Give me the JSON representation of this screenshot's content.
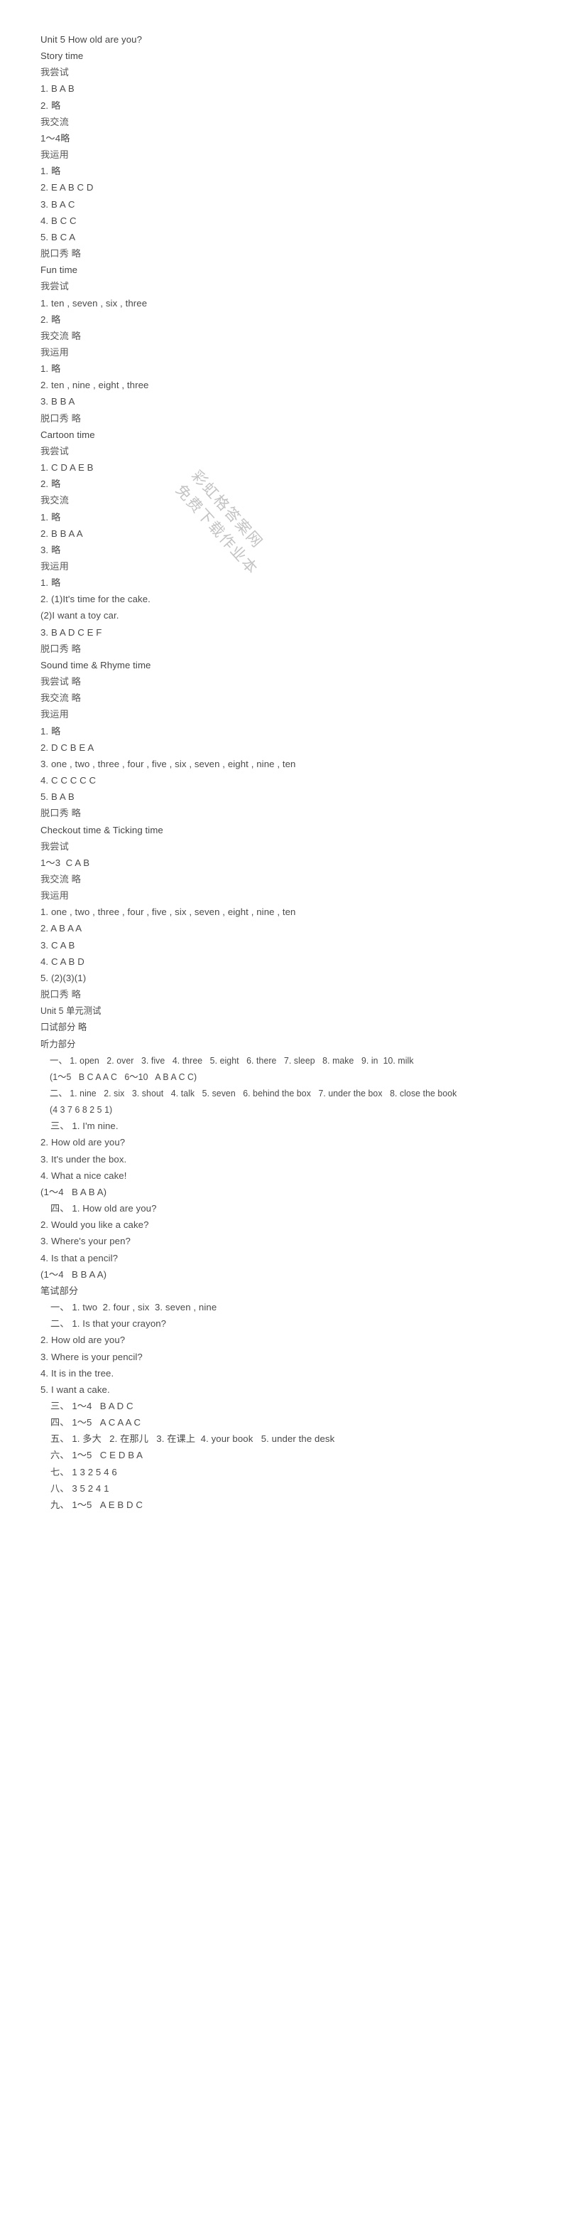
{
  "document": {
    "title": "Unit 5 How old are you?",
    "watermark": {
      "lines": [
        "彩虹格答案网",
        "免费下载作业本"
      ],
      "color": "#b9b9b9"
    },
    "body_lines": [
      {
        "text": "Unit 5 How old are you?",
        "style": "hd"
      },
      {
        "text": "Story time",
        "style": "hd"
      },
      {
        "text": "我尝试",
        "style": "cn"
      },
      {
        "text": "1. B A B",
        "style": ""
      },
      {
        "text": "2. 略",
        "style": ""
      },
      {
        "text": "我交流",
        "style": "cn"
      },
      {
        "text": "1～4略",
        "style": ""
      },
      {
        "text": "我运用",
        "style": "cn"
      },
      {
        "text": "1. 略",
        "style": ""
      },
      {
        "text": "2. E A B C D",
        "style": ""
      },
      {
        "text": "3. B A C",
        "style": ""
      },
      {
        "text": "4. B C C",
        "style": ""
      },
      {
        "text": "5. B C A",
        "style": ""
      },
      {
        "text": "脱口秀 略",
        "style": "cn"
      },
      {
        "text": "Fun time",
        "style": "hd"
      },
      {
        "text": "我尝试",
        "style": "cn"
      },
      {
        "text": "1. ten , seven , six , three",
        "style": ""
      },
      {
        "text": "2. 略",
        "style": ""
      },
      {
        "text": "我交流 略",
        "style": "cn"
      },
      {
        "text": "我运用",
        "style": "cn"
      },
      {
        "text": "1. 略",
        "style": ""
      },
      {
        "text": "2. ten , nine , eight , three",
        "style": ""
      },
      {
        "text": "3. B B A",
        "style": ""
      },
      {
        "text": "脱口秀 略",
        "style": "cn"
      },
      {
        "text": "Cartoon time",
        "style": "hd"
      },
      {
        "text": "我尝试",
        "style": "cn"
      },
      {
        "text": "1. C D A E B",
        "style": ""
      },
      {
        "text": "2. 略",
        "style": ""
      },
      {
        "text": "我交流",
        "style": "cn"
      },
      {
        "text": "1. 略",
        "style": ""
      },
      {
        "text": "2. B B A A",
        "style": ""
      },
      {
        "text": "3. 略",
        "style": ""
      },
      {
        "text": "我运用",
        "style": "cn"
      },
      {
        "text": "1. 略",
        "style": ""
      },
      {
        "text": "2. (1)It's time for the cake.",
        "style": ""
      },
      {
        "text": "(2)I want a toy car.",
        "style": ""
      },
      {
        "text": "3. B A D C E F",
        "style": ""
      },
      {
        "text": "脱口秀 略",
        "style": "cn"
      },
      {
        "text": "Sound time & Rhyme time",
        "style": "hd"
      },
      {
        "text": "我尝试 略",
        "style": "cn"
      },
      {
        "text": "我交流 略",
        "style": "cn"
      },
      {
        "text": "我运用",
        "style": "cn"
      },
      {
        "text": "1. 略",
        "style": ""
      },
      {
        "text": "2. D C B E A",
        "style": ""
      },
      {
        "text": "3. one , two , three , four , five , six , seven , eight , nine , ten",
        "style": ""
      },
      {
        "text": "4. C C C C C",
        "style": ""
      },
      {
        "text": "5. B A B",
        "style": ""
      },
      {
        "text": "脱口秀 略",
        "style": "cn"
      },
      {
        "text": "Checkout time & Ticking time",
        "style": "hd"
      },
      {
        "text": "我尝试",
        "style": "cn"
      },
      {
        "text": "1～3  C A B",
        "style": ""
      },
      {
        "text": "我交流 略",
        "style": "cn"
      },
      {
        "text": "我运用",
        "style": "cn"
      },
      {
        "text": "1. one , two , three , four , five , six , seven , eight , nine , ten",
        "style": ""
      },
      {
        "text": "2. A B A A",
        "style": ""
      },
      {
        "text": "3. C A B",
        "style": ""
      },
      {
        "text": "4. C A B D",
        "style": ""
      },
      {
        "text": "5. (2)(3)(1)",
        "style": ""
      },
      {
        "text": "脱口秀 略",
        "style": "cn"
      },
      {
        "text": "Unit 5 单元测试",
        "style": "cond"
      },
      {
        "text": "口试部分 略",
        "style": "cond"
      },
      {
        "text": "听力部分",
        "style": "cond"
      },
      {
        "text": "一、 1. open   2. over   3. five   4. three   5. eight   6. there   7. sleep   8. make   9. in  10. milk",
        "style": "cond indent"
      },
      {
        "text": "(1～5   B C A A C   6～10   A B A C C)",
        "style": "cond indent"
      },
      {
        "text": "二、 1. nine   2. six   3. shout   4. talk   5. seven   6. behind the box   7. under the box   8. close the book",
        "style": "cond indent"
      },
      {
        "text": "(4 3 7 6 8 2 5 1)",
        "style": "cond indent"
      },
      {
        "text": "三、 1. I'm nine.",
        "style": "indent"
      },
      {
        "text": "2. How old are you?",
        "style": ""
      },
      {
        "text": "3. It's under the box.",
        "style": ""
      },
      {
        "text": "4. What a nice cake!",
        "style": ""
      },
      {
        "text": "(1～4   B A B A)",
        "style": ""
      },
      {
        "text": "四、 1. How old are you?",
        "style": "indent"
      },
      {
        "text": "2. Would you like a cake?",
        "style": ""
      },
      {
        "text": "3. Where's your pen?",
        "style": ""
      },
      {
        "text": "4. Is that a pencil?",
        "style": ""
      },
      {
        "text": "(1～4   B B A A)",
        "style": ""
      },
      {
        "text": "笔试部分",
        "style": ""
      },
      {
        "text": "一、 1. two  2. four , six  3. seven , nine",
        "style": "indent"
      },
      {
        "text": "二、 1. Is that your crayon?",
        "style": "indent"
      },
      {
        "text": "2. How old are you?",
        "style": ""
      },
      {
        "text": "3. Where is your pencil?",
        "style": ""
      },
      {
        "text": "4. It is in the tree.",
        "style": ""
      },
      {
        "text": "5. I want a cake.",
        "style": ""
      },
      {
        "text": "三、 1～4   B A D C",
        "style": "indent"
      },
      {
        "text": "四、 1～5   A C A A C",
        "style": "indent"
      },
      {
        "text": "五、 1. 多大   2. 在那儿   3. 在课上  4. your book   5. under the desk",
        "style": "indent"
      },
      {
        "text": "六、 1～5   C E D B A",
        "style": "indent"
      },
      {
        "text": "七、 1 3 2 5 4 6",
        "style": "indent"
      },
      {
        "text": "八、 3 5 2 4 1",
        "style": "indent"
      },
      {
        "text": "九、 1～5   A E B D C",
        "style": "indent"
      }
    ]
  }
}
